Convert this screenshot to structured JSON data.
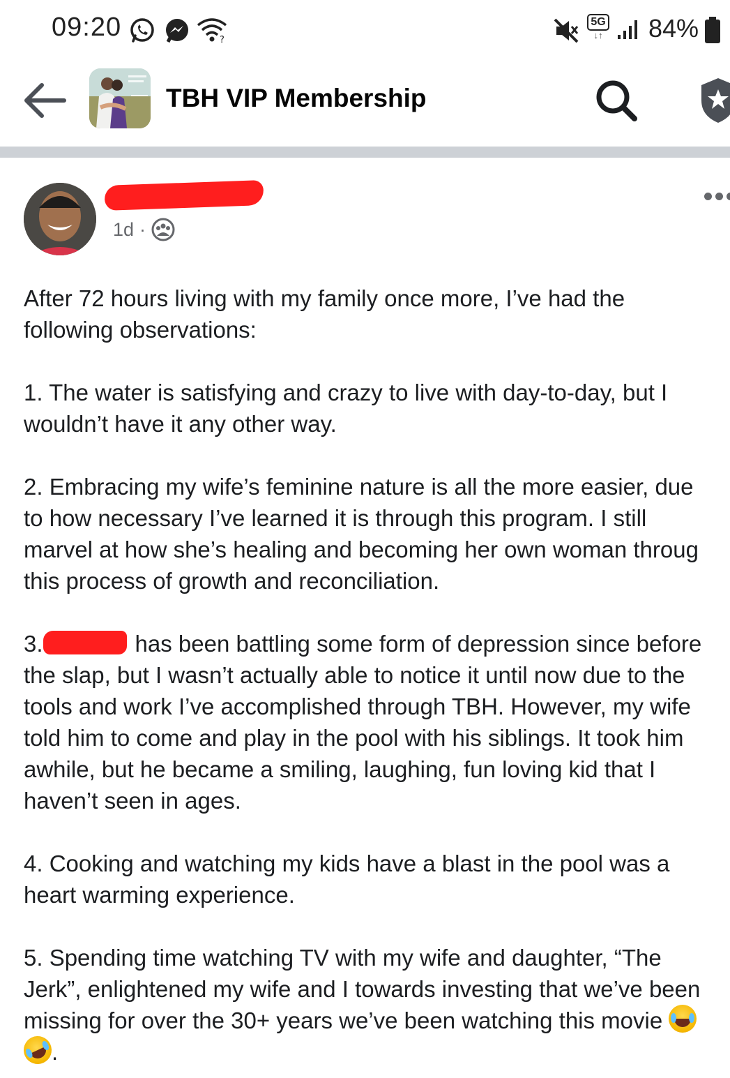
{
  "status_bar": {
    "time": "09:20",
    "network": "5G",
    "battery": "84%",
    "left_icons": [
      "whatsapp-icon",
      "messenger-icon",
      "wifi-icon"
    ],
    "right_icons": [
      "mute-icon",
      "5g-icon",
      "signal-icon",
      "battery-icon"
    ]
  },
  "header": {
    "title": "TBH VIP Membership"
  },
  "post": {
    "time": "1d",
    "separator": "·",
    "audience_icon": "group-audience-icon",
    "intro": "After 72 hours living with my family once more, I’ve had the following observations:",
    "items": [
      "1. The water is satisfying and crazy to live with day-to-day, but I wouldn’t have it any other way.",
      "2. Embracing my wife’s feminine nature is all the more easier, due to how necessary I’ve learned it is through this program. I still marvel at how she’s healing and becoming her own woman through this process of growth and reconciliation.",
      "has been battling some form of depression since before the slap, but I wasn’t actually able to notice it until now due to the tools and work I’ve accomplished through TBH. However, my wife told him to come and play in the pool with his siblings. It took him awhile, but he became a smiling, laughing, fun loving kid that I haven’t seen in ages.",
      "4. Cooking and watching my kids have a blast in the pool was a heart warming experience.",
      "5. Spending time watching TV with my wife and daughter,  “The Jerk”, enlightened my wife and I towards investing that we’ve been missing for over the 30+ years we’ve been watching this movie"
    ],
    "lines": {
      "intro_1": "After 72 hours living with my family once more, I’ve had the",
      "intro_2": "following observations:",
      "p1_1": "1. The water is satisfying and crazy to live with day-to-day, but I",
      "p1_2": "wouldn’t have it any other way.",
      "p2_1": "2. Embracing my wife’s feminine nature is all the more easier, due",
      "p2_2": "to how necessary I’ve learned it is through this program. I still",
      "p2_3": "marvel at how she’s healing and becoming her own woman throug",
      "p2_4": "this process of growth and reconciliation.",
      "p3_num": "3.",
      "p3_1": "has been battling some form of depression since before",
      "p3_2": "the slap, but I wasn’t actually able to notice it until now due to the",
      "p3_3": "tools and work I’ve accomplished through TBH. However, my wife",
      "p3_4": "told him to come and play in the pool with his siblings. It took him",
      "p3_5": "awhile, but he became a smiling, laughing, fun loving kid that I",
      "p3_6": "haven’t seen in ages.",
      "p4_1": "4. Cooking and watching my kids have a blast in the pool was a",
      "p4_2": "heart warming experience.",
      "p5_1": "5. Spending time watching TV with my wife and daughter,  “The",
      "p5_2": "Jerk”, enlightened my wife and I towards investing that we’ve been",
      "p5_3": "missing for over the 30+ years we’ve been watching this movie",
      "p5_end": "."
    },
    "emojis": [
      "face-with-tears-of-joy",
      "rolling-on-the-floor-laughing"
    ]
  }
}
